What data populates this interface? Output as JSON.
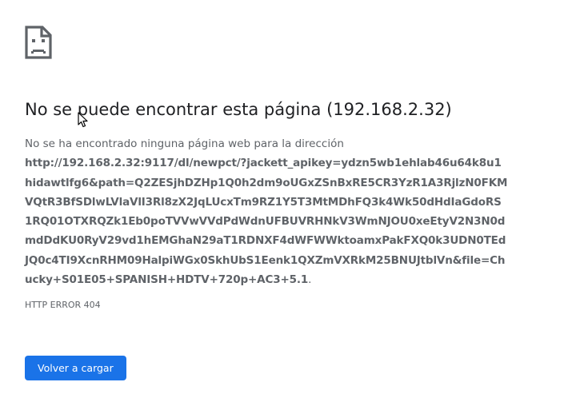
{
  "page": {
    "icon": "sad-page-icon",
    "title": "No se puede encontrar esta página (192.168.2.32)",
    "description": "No se ha encontrado ninguna página web para la dirección",
    "url": "http://192.168.2.32:9117/dl/newpct/?jackett_apikey=ydzn5wb1ehlab46u64k8u1hidawtlfg6&path=Q2ZESjhDZHp1Q0h2dm9oUGxZSnBxRE5CR3YzR1A3RjlzN0FKMVQtR3BfSDlwLVlaVlI3Rl8zX2JqLUcxTm9RZ1Y5T3MtMDhFQ3k4Wk50dHdIaGdoRS1RQ01OTXRQZk1Eb0poTVVwVVdPdWdnUFBUVRHNkV3WmNJOU0xeEtyV2N3N0dmdDdKU0RyV29vd1hEMGhaN29aT1RDNXF4dWFWWktoamxPakFXQ0k3UDN0TEdJQ0c4TI9XcnRHM09HalpiWGx0SkhUbS1Eenk1QXZmVXRkM25BNUJtblVn&file=Chucky+S01E05+SPANISH+HDTV+720p+AC3+5.1",
    "url_end": ".",
    "error_code": "HTTP ERROR 404",
    "reload_label": "Volver a cargar"
  },
  "colors": {
    "title": "#202124",
    "body_text": "#5f6368",
    "button_bg": "#1a73e8",
    "button_text": "#ffffff"
  }
}
